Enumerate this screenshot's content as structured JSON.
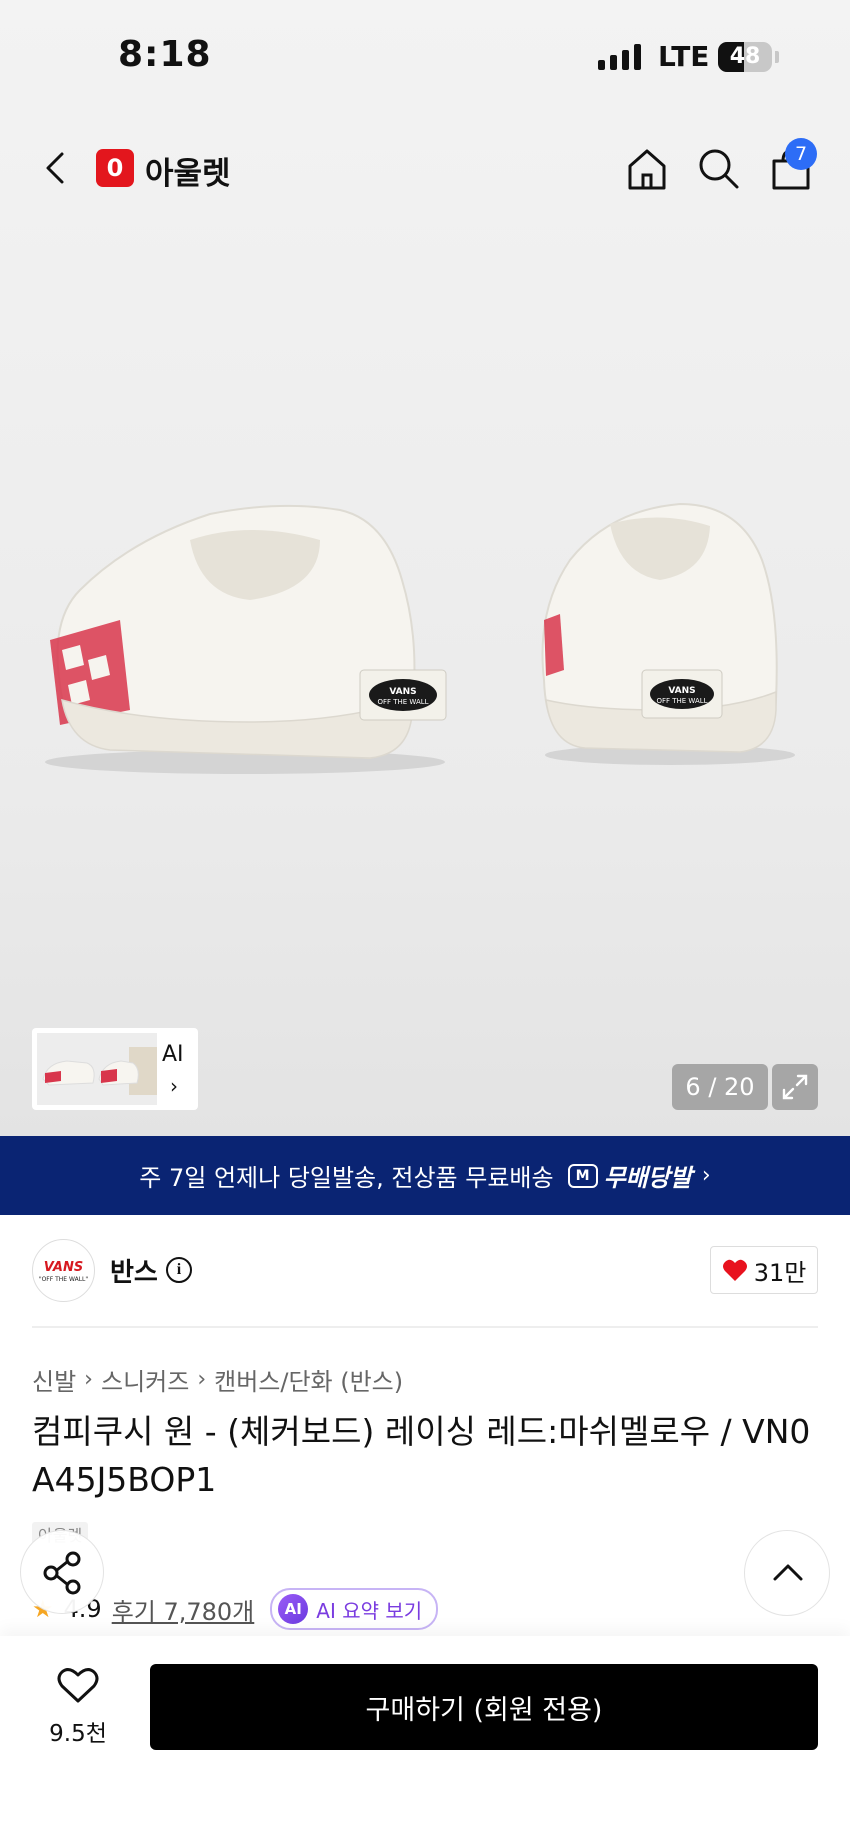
{
  "status_bar": {
    "time": "8:18",
    "network": "LTE",
    "battery": "48",
    "battery_level": 0.48
  },
  "header": {
    "logo_mark": "0",
    "logo_text": "아울렛",
    "cart_count": "7",
    "icons": [
      "back-icon",
      "home-icon",
      "search-icon",
      "cart-icon"
    ]
  },
  "gallery": {
    "thumb_label": "AI",
    "counter": "6 / 20",
    "current": 6,
    "total": 20
  },
  "banner": {
    "text": "주 7일 언제나 당일발송, 전상품 무료배송",
    "badge_mark": "M",
    "badge_text": "무배당발"
  },
  "brand": {
    "logo_text": "VANS",
    "logo_sub": "\"OFF THE WALL\"",
    "name": "반스",
    "likes": "31만"
  },
  "breadcrumb": [
    "신발",
    "스니커즈",
    "캔버스/단화 (반스)"
  ],
  "product": {
    "title": "컴피쿠시 원 - (체커보드) 레이싱 레드:마쉬멜로우 / VN0A45J5BOP1",
    "tag": "아울렛",
    "rating": "4.9",
    "reviews": "후기 7,780개",
    "ai_badge": "AI",
    "ai_summary": "AI 요약 보기"
  },
  "bottom": {
    "wish_count": "9.5천",
    "buy_label": "구매하기 (회원 전용)"
  },
  "colors": {
    "brand_red": "#e3161d",
    "banner_navy": "#0a2473",
    "badge_blue": "#2d6df6",
    "ai_purple": "#7a3ce0"
  }
}
